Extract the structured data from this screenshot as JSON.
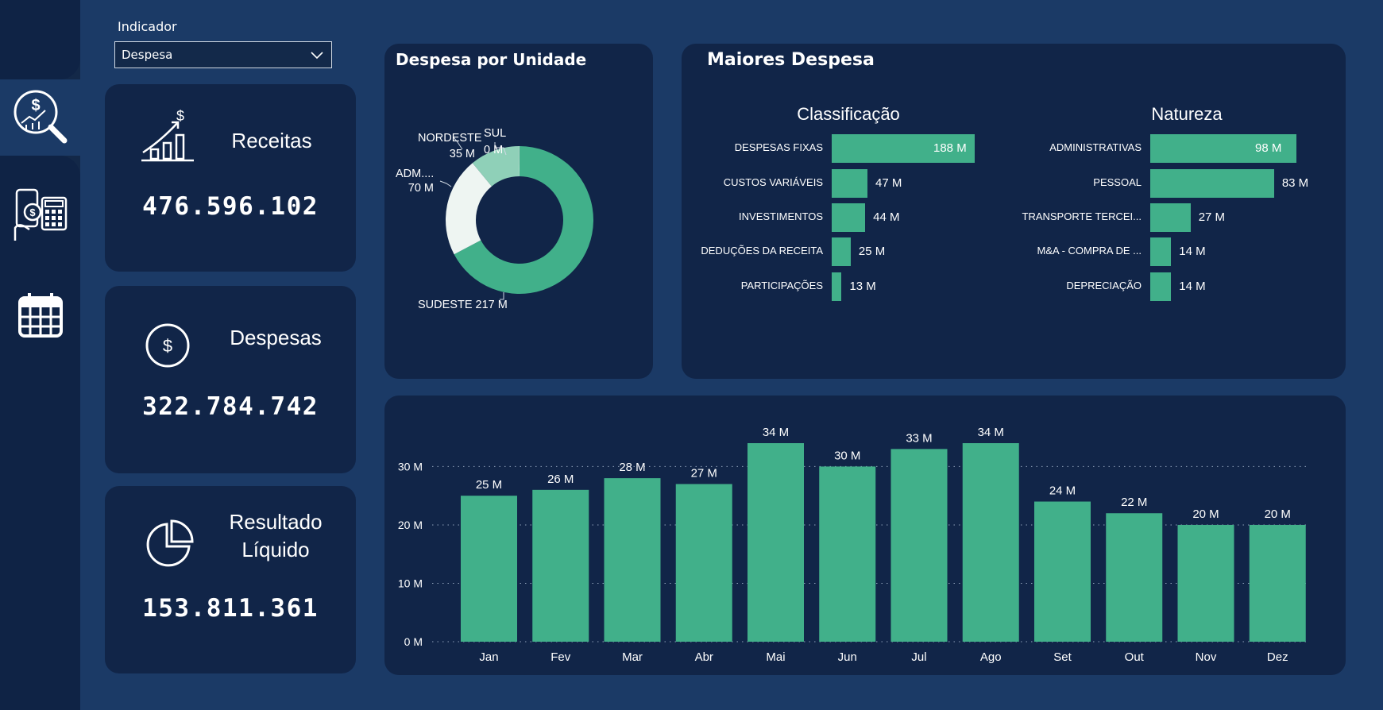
{
  "indicator": {
    "label": "Indicador",
    "selected": "Despesa"
  },
  "nav": {
    "items": [
      {
        "icon": "finance-analysis-icon",
        "active": true
      },
      {
        "icon": "calculator-payment-icon",
        "active": false
      },
      {
        "icon": "calendar-icon",
        "active": false
      }
    ]
  },
  "kpis": {
    "receitas": {
      "title": "Receitas",
      "value": "476.596.102",
      "icon": "growth-chart-icon"
    },
    "despesas": {
      "title": "Despesas",
      "value": "322.784.742",
      "icon": "dollar-coin-icon"
    },
    "resultado": {
      "title_line1": "Resultado",
      "title_line2": "Líquido",
      "value": "153.811.361",
      "icon": "pie-chart-icon"
    }
  },
  "donut": {
    "title": "Despesa por Unidade",
    "accent": "#41b08a",
    "slices": [
      {
        "name": "SUDESTE",
        "value": 217,
        "label": "SUDESTE 217 M",
        "color": "#41b08a"
      },
      {
        "name": "ADM....",
        "value": 70,
        "label_line1": "ADM....",
        "label_line2": "70 M",
        "color": "#eef5f2"
      },
      {
        "name": "NORDESTE",
        "value": 35,
        "label_line1": "NORDESTE",
        "label_line2": "35 M",
        "color": "#8fd0b8"
      },
      {
        "name": "SUL",
        "value": 0.4,
        "label_line1": "SUL",
        "label_line2": "0 M",
        "color": "#cfe9df"
      }
    ]
  },
  "maiores": {
    "title": "Maiores Despesa",
    "classificacao": {
      "title": "Classificação",
      "rows": [
        {
          "label": "DESPESAS FIXAS",
          "value": 188,
          "display": "188 M"
        },
        {
          "label": "CUSTOS VARIÁVEIS",
          "value": 47,
          "display": "47 M"
        },
        {
          "label": "INVESTIMENTOS",
          "value": 44,
          "display": "44 M"
        },
        {
          "label": "DEDUÇÕES DA RECEITA",
          "value": 25,
          "display": "25 M"
        },
        {
          "label": "PARTICIPAÇÕES",
          "value": 13,
          "display": "13 M"
        }
      ]
    },
    "natureza": {
      "title": "Natureza",
      "rows": [
        {
          "label": "ADMINISTRATIVAS",
          "value": 98,
          "display": "98 M"
        },
        {
          "label": "PESSOAL",
          "value": 83,
          "display": "83 M"
        },
        {
          "label": "TRANSPORTE TERCEI...",
          "value": 27,
          "display": "27 M"
        },
        {
          "label": "M&A - COMPRA DE ...",
          "value": 14,
          "display": "14 M"
        },
        {
          "label": "DEPRECIAÇÃO",
          "value": 14,
          "display": "14 M"
        }
      ]
    }
  },
  "chart_data": {
    "type": "bar",
    "categories": [
      "Jan",
      "Fev",
      "Mar",
      "Abr",
      "Mai",
      "Jun",
      "Jul",
      "Ago",
      "Set",
      "Out",
      "Nov",
      "Dez"
    ],
    "values": [
      25,
      26,
      28,
      27,
      34,
      30,
      33,
      34,
      24,
      22,
      20,
      20
    ],
    "labels": [
      "25 M",
      "26 M",
      "28 M",
      "27 M",
      "34 M",
      "30 M",
      "33 M",
      "34 M",
      "24 M",
      "22 M",
      "20 M",
      "20 M"
    ],
    "yticks": [
      0,
      10,
      20,
      30
    ],
    "ytick_labels": [
      "0 M",
      "10 M",
      "20 M",
      "30 M"
    ],
    "ylim": [
      0,
      34
    ],
    "grid": true,
    "color": "#41b08a"
  }
}
